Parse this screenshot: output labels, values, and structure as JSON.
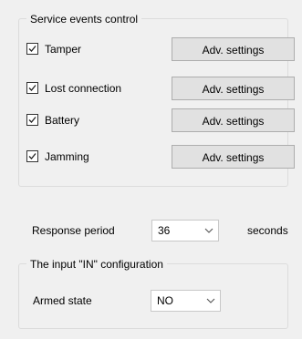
{
  "service_events": {
    "title": "Service events control",
    "items": [
      {
        "label": "Tamper",
        "checked": true,
        "button": "Adv. settings"
      },
      {
        "label": "Lost connection",
        "checked": true,
        "button": "Adv. settings"
      },
      {
        "label": "Battery",
        "checked": true,
        "button": "Adv. settings"
      },
      {
        "label": "Jamming",
        "checked": true,
        "button": "Adv. settings"
      }
    ]
  },
  "response_period": {
    "label": "Response period",
    "value": "36",
    "unit": "seconds"
  },
  "input_in": {
    "title": "The input \"IN\" configuration",
    "armed_state_label": "Armed state",
    "armed_state_value": "NO"
  }
}
